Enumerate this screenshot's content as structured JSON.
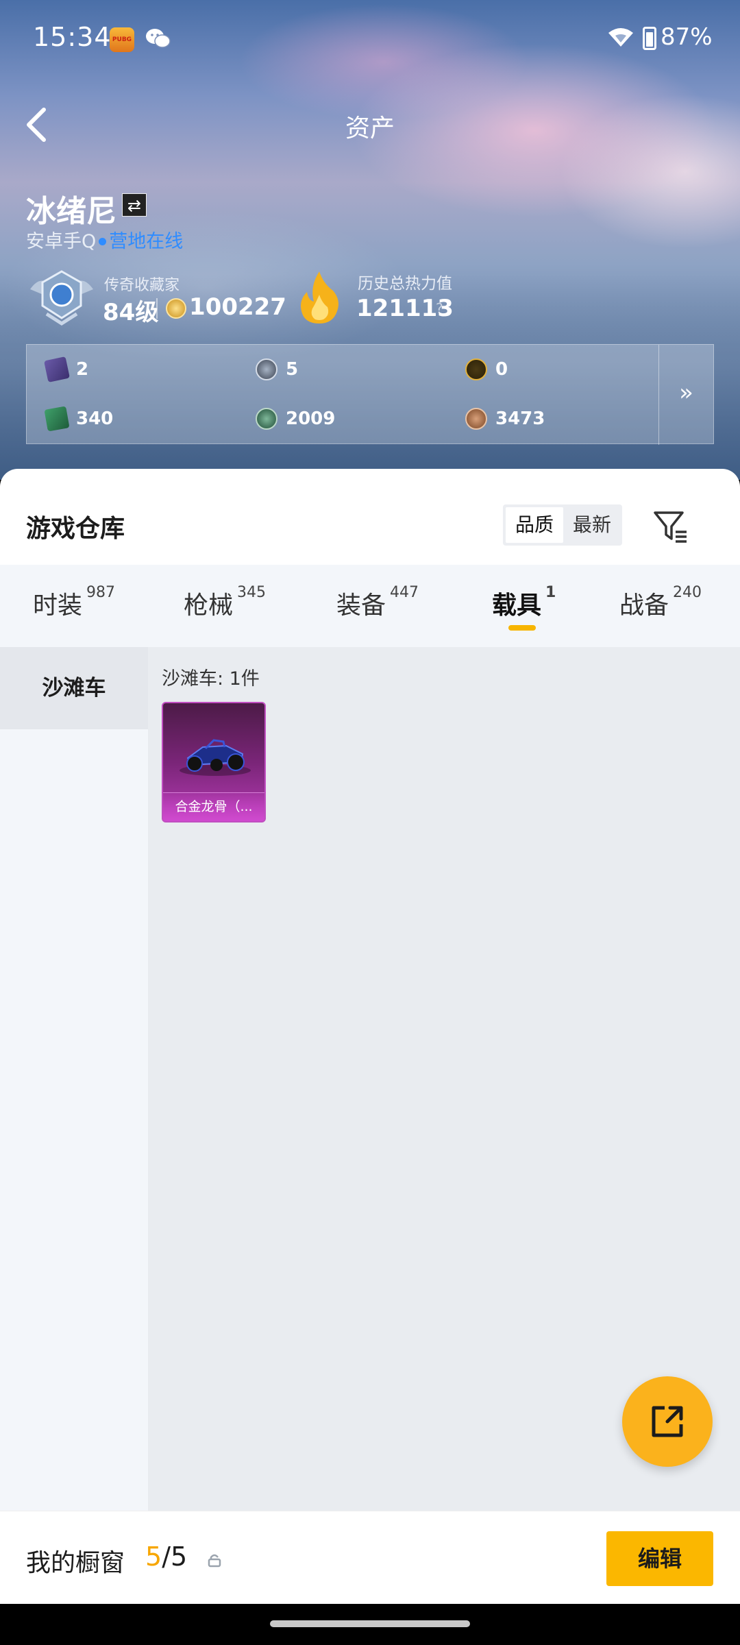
{
  "status_bar": {
    "time": "15:34",
    "app_badge": "和平精英",
    "battery": "87%"
  },
  "header": {
    "title": "资产"
  },
  "profile": {
    "name": "冰绪尼",
    "platform": "安卓手Q",
    "online_status": "营地在线",
    "collector_title": "传奇收藏家",
    "level": "84级",
    "coins": "100227",
    "heat_title": "历史总热力值",
    "heat_value": "121113",
    "heat_help": "?"
  },
  "stats": [
    {
      "icon": "purple-card-icon",
      "value": "2"
    },
    {
      "icon": "dark-token-icon",
      "value": "5"
    },
    {
      "icon": "gold-token-icon",
      "value": "0"
    },
    {
      "icon": "green-card-icon",
      "value": "340"
    },
    {
      "icon": "green-coin-icon",
      "value": "2009"
    },
    {
      "icon": "bronze-coin-icon",
      "value": "3473"
    }
  ],
  "stats_more": "»",
  "warehouse": {
    "title": "游戏仓库",
    "sort_options": [
      "品质",
      "最新"
    ],
    "active_sort": "品质"
  },
  "tabs": [
    {
      "label": "时装",
      "count": "987"
    },
    {
      "label": "枪械",
      "count": "345"
    },
    {
      "label": "装备",
      "count": "447"
    },
    {
      "label": "载具",
      "count": "1"
    },
    {
      "label": "战备",
      "count": "240"
    }
  ],
  "active_tab": "载具",
  "sidebar": {
    "items": [
      "沙滩车"
    ]
  },
  "content": {
    "category_count": "沙滩车: 1件",
    "items": [
      {
        "name": "合金龙骨（..."
      }
    ]
  },
  "bottom_bar": {
    "label": "我的橱窗",
    "current": "5",
    "total": "/5",
    "edit_label": "编辑"
  },
  "colors": {
    "accent": "#fbb700",
    "online": "#2f8cff",
    "rarity_purple": "#b43bb2"
  }
}
